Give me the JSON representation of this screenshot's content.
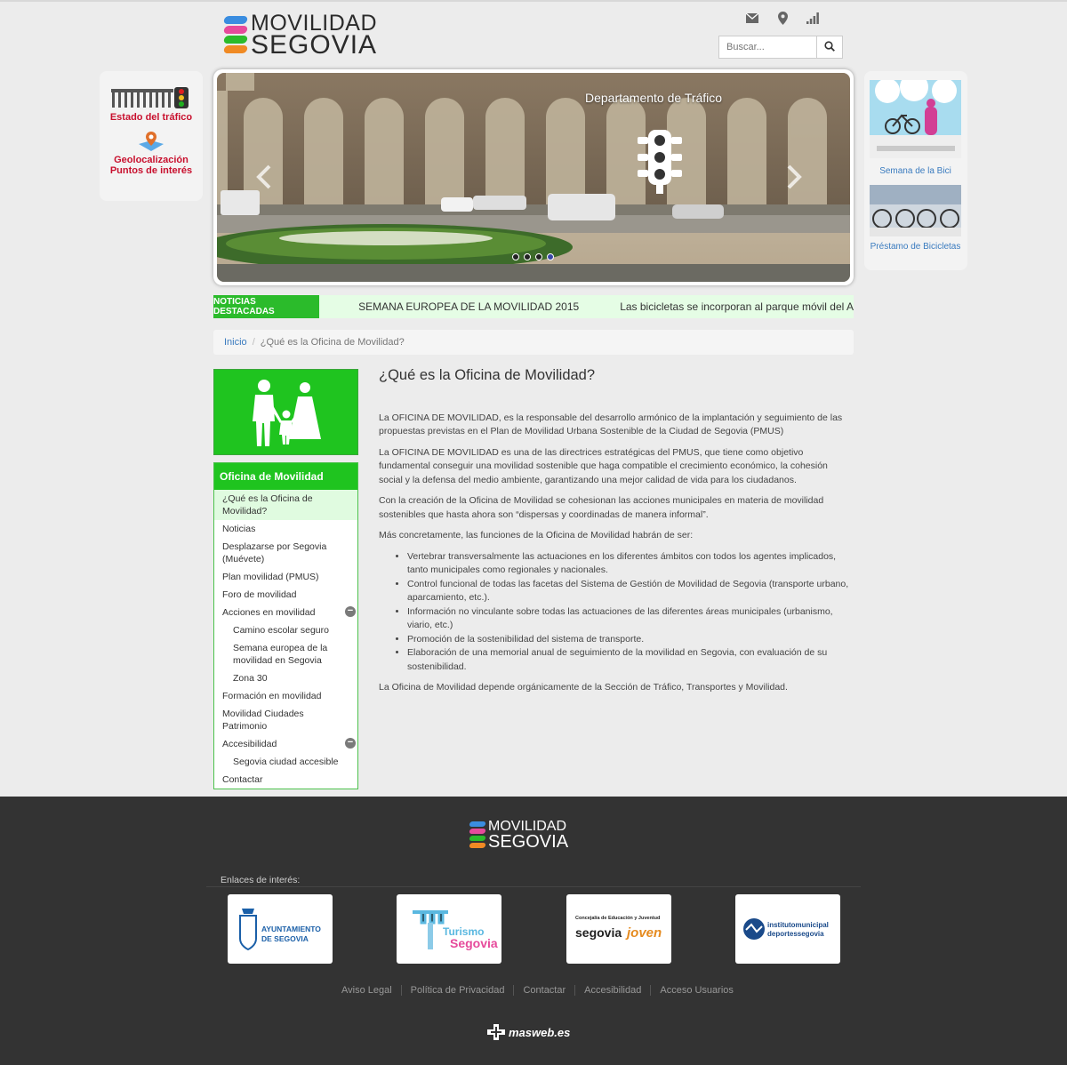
{
  "brand": {
    "line1": "MOVILIDAD",
    "line2": "SEGOVIA",
    "colors": [
      "#3a8de0",
      "#e64a9b",
      "#2bbb2b",
      "#f08a24"
    ]
  },
  "header_icons": [
    "envelope-icon",
    "map-marker-icon",
    "signal-bars-icon"
  ],
  "search": {
    "placeholder": "Buscar...",
    "button_icon": "magnifier-icon"
  },
  "left_links": [
    {
      "label": "Estado del tráfico",
      "icon": "traffic-aqueduct-icon"
    },
    {
      "label": "Geolocalización Puntos de interés",
      "icon": "geolocation-map-icon"
    }
  ],
  "right_links": [
    {
      "label": "Semana de la Bici"
    },
    {
      "label": "Préstamo de Bicicletas"
    }
  ],
  "slider": {
    "title": "Departamento de Tráfico",
    "icon": "traffic-light-icon",
    "slides": 4,
    "active_slide": 4
  },
  "ticker": {
    "label": "NOTICIAS DESTACADAS",
    "items": [
      "SEMANA EUROPEA DE LA MOVILIDAD 2015",
      "Las bicicletas se incorporan al parque móvil del A"
    ]
  },
  "breadcrumb": {
    "home": "Inicio",
    "current": "¿Qué es la Oficina de Movilidad?"
  },
  "sidebar": {
    "heading": "Oficina de Movilidad",
    "items": [
      {
        "label": "¿Qué es la Oficina de Movilidad?",
        "active": true,
        "sub": false
      },
      {
        "label": "Noticias",
        "sub": false
      },
      {
        "label": "Desplazarse por Segovia (Muévete)",
        "sub": false
      },
      {
        "label": "Plan movilidad (PMUS)",
        "sub": false
      },
      {
        "label": "Foro de movilidad",
        "sub": false
      },
      {
        "label": "Acciones en movilidad",
        "sub": false,
        "toggle": true
      },
      {
        "label": "Camino escolar seguro",
        "sub": true
      },
      {
        "label": "Semana europea de la movilidad en Segovia",
        "sub": true
      },
      {
        "label": "Zona 30",
        "sub": true
      },
      {
        "label": "Formación en movilidad",
        "sub": false
      },
      {
        "label": "Movilidad Ciudades Patrimonio",
        "sub": false
      },
      {
        "label": "Accesibilidad",
        "sub": false,
        "toggle": true
      },
      {
        "label": "Segovia ciudad accesible",
        "sub": true
      },
      {
        "label": "Contactar",
        "sub": false
      }
    ]
  },
  "article": {
    "title": "¿Qué es la Oficina de Movilidad?",
    "p1": "La OFICINA DE MOVILIDAD, es la responsable del desarrollo armónico de la implantación y seguimiento de las propuestas previstas en el Plan de Movilidad Urbana Sostenible de la Ciudad de Segovia (PMUS)",
    "p2": "La OFICINA DE MOVILIDAD es una de las directrices estratégicas del PMUS, que tiene como objetivo fundamental conseguir una movilidad sostenible que haga compatible el crecimiento económico, la cohesión social y la defensa del medio ambiente, garantizando una mejor calidad de vida para los ciudadanos.",
    "p3": "Con la creación de la Oficina de Movilidad se cohesionan las acciones municipales en materia de movilidad sostenibles que hasta ahora son “dispersas y coordinadas de manera informal”.",
    "p4": "Más concretamente, las funciones de la Oficina de Movilidad habrán de ser:",
    "list": [
      "Vertebrar transversalmente las actuaciones en los diferentes ámbitos con todos los agentes implicados, tanto municipales como regionales y nacionales.",
      "Control funcional de todas las facetas del Sistema de Gestión de Movilidad de Segovia (transporte urbano, aparcamiento, etc.).",
      "Información no vinculante sobre todas las actuaciones de las diferentes áreas municipales (urbanismo, viario, etc.)",
      "Promoción de la sostenibilidad del sistema de transporte.",
      "Elaboración de una memorial anual de seguimiento de la movilidad en Segovia, con evaluación de su sostenibilidad."
    ],
    "p5": "La Oficina de Movilidad depende orgánicamente de la Sección de Tráfico, Transportes y Movilidad."
  },
  "footer": {
    "links_title": "Enlaces de interés:",
    "partners": [
      {
        "name": "AYUNTAMIENTO DE SEGOVIA",
        "color": "#1a5fa8"
      },
      {
        "name": "Turismo de Segovia",
        "color": "#e64a9b"
      },
      {
        "name": "Concejalía de Educación y Juventud segovia joven",
        "color": "#222222"
      },
      {
        "name": "instituto municipal deportes segovia",
        "color": "#1a4a8a"
      }
    ],
    "nav": [
      "Aviso Legal",
      "Política de Privacidad",
      "Contactar",
      "Accesibilidad",
      "Acceso Usuarios"
    ],
    "credit": "masweb.es"
  }
}
